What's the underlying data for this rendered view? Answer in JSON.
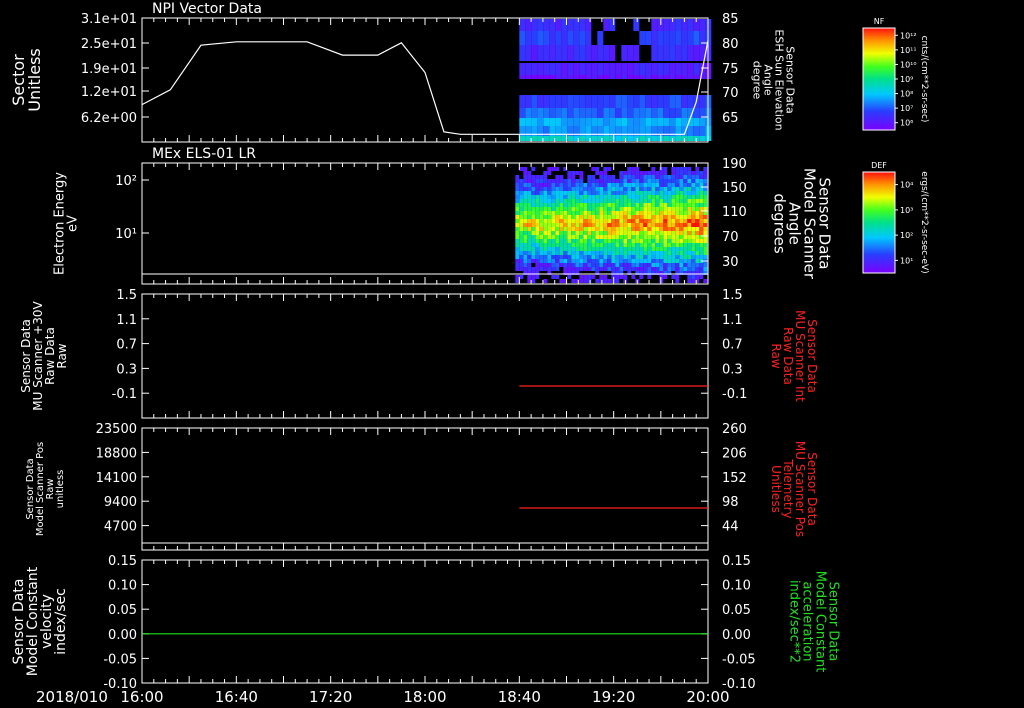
{
  "time_axis": {
    "date": "2018/010",
    "ticks": [
      "16:00",
      "16:40",
      "17:20",
      "18:00",
      "18:40",
      "19:20",
      "20:00"
    ]
  },
  "panels": [
    {
      "title": "NPI Vector Data",
      "left_label": [
        "Sector",
        "Unitless"
      ],
      "right_label": [
        "Sensor Data",
        "ESH Sun Elevation",
        "Angle",
        "degree"
      ],
      "left_ticks": [
        "3.1e+01",
        "2.5e+01",
        "1.9e+01",
        "1.2e+01",
        "6.2e+00"
      ],
      "right_ticks": [
        "85",
        "80",
        "75",
        "70",
        "65"
      ],
      "colorbar": {
        "title": "NF",
        "unit": "cnts/(cm**2-sr-sec)",
        "ticks": [
          "10¹²",
          "10¹¹",
          "10¹⁰",
          "10⁹",
          "10⁸",
          "10⁷",
          "10⁶"
        ]
      },
      "right_label_color": "#ffffff"
    },
    {
      "title": "MEx ELS-01 LR",
      "left_label": [
        "Electron Energy",
        "eV"
      ],
      "right_label": [
        "Sensor Data",
        "Model Scanner",
        "Angle",
        "degrees"
      ],
      "left_ticks": [
        "10²",
        "10¹"
      ],
      "right_ticks": [
        "190",
        "150",
        "110",
        "70",
        "30"
      ],
      "colorbar": {
        "title": "DEF",
        "unit": "ergs/(cm**2-sr-sec-eV)",
        "ticks": [
          "10⁴",
          "10³",
          "10²",
          "10¹"
        ]
      },
      "right_label_color": "#ffffff"
    },
    {
      "title": "",
      "left_label": [
        "Sensor Data",
        "MU Scanner +30V",
        "Raw Data",
        "Raw"
      ],
      "right_label": [
        "Sensor Data",
        "MU Scanner Int",
        "Raw Data",
        "Raw"
      ],
      "left_ticks": [
        "1.5",
        "1.1",
        "0.7",
        "0.3",
        "-0.1"
      ],
      "right_ticks": [
        "1.5",
        "1.1",
        "0.7",
        "0.3",
        "-0.1"
      ],
      "right_label_color": "#ff2020"
    },
    {
      "title": "",
      "left_label": [
        "Sensor Data",
        "Model Scanner Pos",
        "Raw",
        "unitless"
      ],
      "right_label": [
        "Sensor Data",
        "MU Scanner Pos",
        "Telemetry",
        "Unitless"
      ],
      "left_ticks": [
        "23500",
        "18800",
        "14100",
        "9400",
        "4700"
      ],
      "right_ticks": [
        "260",
        "206",
        "152",
        "98",
        "44"
      ],
      "right_label_color": "#ff2020"
    },
    {
      "title": "",
      "left_label": [
        "Sensor Data",
        "Model Constant",
        "velocity",
        "index/sec"
      ],
      "right_label": [
        "Sensor Data",
        "Model Constant",
        "acceleration",
        "index/sec**2"
      ],
      "left_ticks": [
        "0.15",
        "0.10",
        "0.05",
        "0.00",
        "-0.05",
        "-0.10"
      ],
      "right_ticks": [
        "0.15",
        "0.10",
        "0.05",
        "0.00",
        "-0.05",
        "-0.10"
      ],
      "right_label_color": "#20e020"
    }
  ],
  "chart_data": [
    {
      "type": "line",
      "title": "NPI Vector Data",
      "x_unit": "hours (UT)",
      "xlim": [
        "16:00",
        "20:00"
      ],
      "y_scale": "log",
      "ylim_right": [
        60,
        85
      ],
      "series": [
        {
          "name": "ESH Sun Elevation Angle",
          "color": "#ffffff",
          "x": [
            "16:00",
            "16:12",
            "16:25",
            "16:40",
            "16:55",
            "17:10",
            "17:25",
            "17:40",
            "17:50",
            "18:00",
            "18:08",
            "18:15",
            "18:30",
            "18:40",
            "19:00",
            "19:20",
            "19:35",
            "19:50",
            "19:55",
            "20:00"
          ],
          "y": [
            67.5,
            70.5,
            79.5,
            80.2,
            80.2,
            80.2,
            77.5,
            77.5,
            80.0,
            74.0,
            62.0,
            61.5,
            61.5,
            61.5,
            61.5,
            61.5,
            61.5,
            61.5,
            68.0,
            80.5
          ]
        }
      ],
      "spectrogram": {
        "start": "18:40",
        "end": "20:00",
        "colorbar": "NF"
      }
    },
    {
      "type": "heatmap",
      "title": "MEx ELS-01 LR",
      "y_scale": "log",
      "ylim": [
        1,
        200
      ],
      "ylim_right": [
        10,
        190
      ],
      "data_start": "18:40",
      "data_end": "20:00",
      "peak_energy_eV": [
        15,
        18
      ],
      "series": [
        {
          "name": "Model Scanner Angle",
          "color": "#ffffff",
          "x": [
            "16:00",
            "20:00"
          ],
          "y": [
            15,
            15
          ]
        }
      ]
    },
    {
      "type": "line",
      "ylim": [
        -0.3,
        1.5
      ],
      "series": [
        {
          "name": "MU Scanner Int Raw Data",
          "color": "#ff2020",
          "x": [
            "18:40",
            "20:00"
          ],
          "y": [
            0,
            0
          ],
          "axis": "right"
        }
      ]
    },
    {
      "type": "line",
      "ylim": [
        0,
        23500
      ],
      "ylim_right": [
        0,
        260
      ],
      "series": [
        {
          "name": "MU Scanner Pos Telemetry",
          "color": "#ff2020",
          "x": [
            "18:40",
            "20:00"
          ],
          "y": [
            88,
            88
          ],
          "axis": "right"
        }
      ]
    },
    {
      "type": "line",
      "ylim": [
        -0.1,
        0.15
      ],
      "series": [
        {
          "name": "Model Constant velocity",
          "color": "#20e020",
          "x": [
            "16:00",
            "20:00"
          ],
          "y": [
            0.0,
            0.0
          ]
        }
      ]
    }
  ]
}
